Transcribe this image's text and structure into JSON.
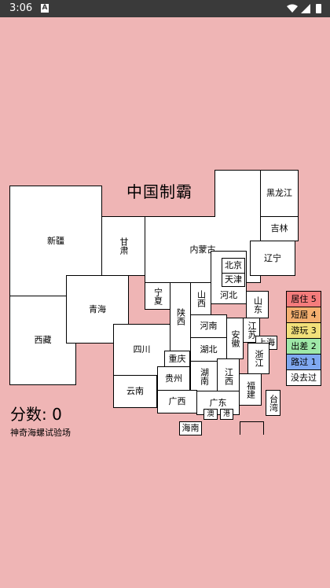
{
  "status_bar": {
    "time": "3:06",
    "notification_icon": "A"
  },
  "title": "中国制霸",
  "provinces": {
    "xinjiang": "新疆",
    "xizang": "西藏",
    "qinghai": "青海",
    "gansu": "甘肃",
    "neimenggu": "内蒙古",
    "heilongjiang": "黑龙江",
    "jilin": "吉林",
    "liaoning": "辽宁",
    "beijing": "北京",
    "tianjin": "天津",
    "hebei": "河北",
    "shanxi": "山西",
    "shandong": "山东",
    "ningxia": "宁夏",
    "shaanxi": "陕西",
    "henan": "河南",
    "jiangsu": "江苏",
    "shanghai": "上海",
    "anhui": "安徽",
    "hubei": "湖北",
    "sichuan": "四川",
    "chongqing": "重庆",
    "guizhou": "贵州",
    "hunan": "湖南",
    "jiangxi": "江西",
    "zhejiang": "浙江",
    "fujian": "福建",
    "yunnan": "云南",
    "guangxi": "广西",
    "guangdong": "广东",
    "taiwan": "台湾",
    "macau": "澳",
    "hongkong": "港",
    "hainan": "海南"
  },
  "legend": [
    {
      "label": "居住 5",
      "color": "#F47C7C"
    },
    {
      "label": "短居 4",
      "color": "#F5B070"
    },
    {
      "label": "游玩 3",
      "color": "#F2E07A"
    },
    {
      "label": "出差 2",
      "color": "#9FE8A8"
    },
    {
      "label": "路过 1",
      "color": "#7FA8F0"
    },
    {
      "label": "没去过",
      "color": "#FFFFFF"
    }
  ],
  "score": {
    "label": "分数:",
    "value": "0"
  },
  "subtitle": "神奇海螺试验场"
}
